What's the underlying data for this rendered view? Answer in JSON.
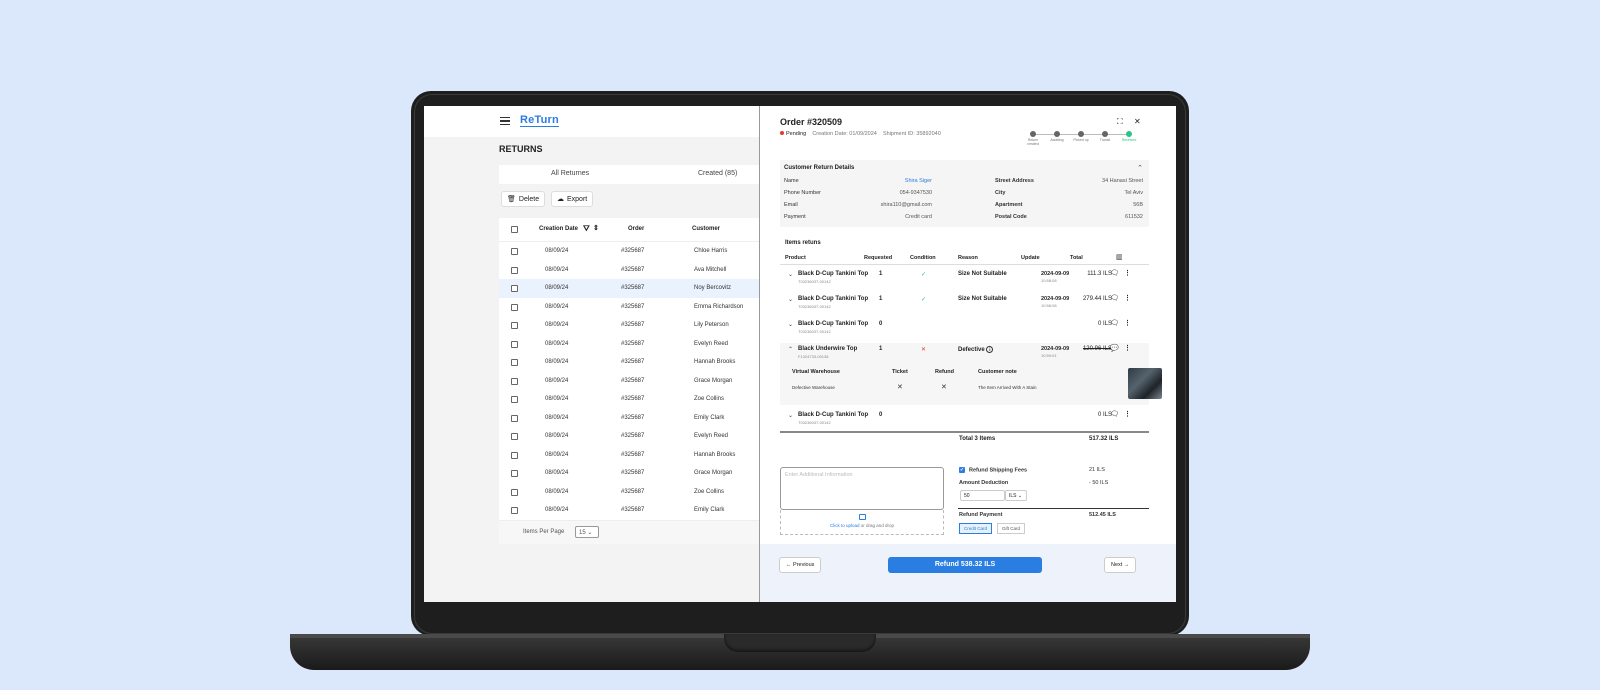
{
  "app": {
    "logo": "ReTurn"
  },
  "left": {
    "title": "RETURNS",
    "tabs": [
      "All Returnes",
      "Created (85)"
    ],
    "actions": {
      "delete": "Delete",
      "export": "Export"
    },
    "columns": [
      "Creation Date",
      "Order",
      "Customer"
    ],
    "rows": [
      {
        "date": "08/09/24",
        "order": "#325687",
        "customer": "Chloe Harris"
      },
      {
        "date": "08/09/24",
        "order": "#325687",
        "customer": "Ava Mitchell"
      },
      {
        "date": "08/09/24",
        "order": "#325687",
        "customer": "Noy Bercovitz"
      },
      {
        "date": "08/09/24",
        "order": "#325687",
        "customer": "Emma Richardson"
      },
      {
        "date": "08/09/24",
        "order": "#325687",
        "customer": "Lily Peterson"
      },
      {
        "date": "08/09/24",
        "order": "#325687",
        "customer": "Evelyn Reed"
      },
      {
        "date": "08/09/24",
        "order": "#325687",
        "customer": "Hannah Brooks"
      },
      {
        "date": "08/09/24",
        "order": "#325687",
        "customer": "Grace Morgan"
      },
      {
        "date": "08/09/24",
        "order": "#325687",
        "customer": "Zoe Collins"
      },
      {
        "date": "08/09/24",
        "order": "#325687",
        "customer": "Emily Clark"
      },
      {
        "date": "08/09/24",
        "order": "#325687",
        "customer": "Evelyn Reed"
      },
      {
        "date": "08/09/24",
        "order": "#325687",
        "customer": "Hannah Brooks"
      },
      {
        "date": "08/09/24",
        "order": "#325687",
        "customer": "Grace Morgan"
      },
      {
        "date": "08/09/24",
        "order": "#325687",
        "customer": "Zoe Collins"
      },
      {
        "date": "08/09/24",
        "order": "#325687",
        "customer": "Emily Clark"
      }
    ],
    "footer": {
      "items_label": "Items Per Page",
      "items_value": "15"
    }
  },
  "order": {
    "title": "Order #320509",
    "status": "Pending",
    "creation": "Creation Date: 01/09/2024",
    "shipment": "Shipment ID: 35892040",
    "steps": [
      "Return created",
      "Awaiting",
      "Picked up",
      "Transit",
      "Received"
    ]
  },
  "customer": {
    "header": "Customer Return Details",
    "left": [
      {
        "label": "Name",
        "value": "Shira Siger"
      },
      {
        "label": "Phone Number",
        "value": "054-9347530"
      },
      {
        "label": "Email",
        "value": "shira110@gmail.com"
      },
      {
        "label": "Payment",
        "value": "Credit card"
      }
    ],
    "right": [
      {
        "label": "Street Address",
        "value": "34 Hanasi Street"
      },
      {
        "label": "City",
        "value": "Tel Aviv"
      },
      {
        "label": "Apartment",
        "value": "56B"
      },
      {
        "label": "Postal Code",
        "value": "611532"
      }
    ]
  },
  "items": {
    "header": "Items retuns",
    "columns": [
      "Product",
      "Requested",
      "Condition",
      "Reason",
      "Update",
      "Total"
    ],
    "rows": [
      {
        "name": "Black D-Cup Tankini Top",
        "sku": "T03236037-00142",
        "requested": "1",
        "reason": "Size Not Suitable",
        "date": "2024-09-09",
        "time": "10:58:08",
        "total": "111.3 ILS"
      },
      {
        "name": "Black D-Cup Tankini Top",
        "sku": "T03236037-00142",
        "requested": "1",
        "reason": "Size Not Suitable",
        "date": "2024-09-09",
        "time": "10:58:08",
        "total": "279.44 ILS"
      },
      {
        "name": "Black D-Cup Tankini Top",
        "sku": "T03236037-00142",
        "requested": "0",
        "reason": "",
        "date": "",
        "time": "",
        "total": "0 ILS"
      },
      {
        "name": "Black Underwire Top",
        "sku": "F1324733-00138",
        "requested": "1",
        "reason": "Defective",
        "date": "2024-09-09",
        "time": "10:59:01",
        "total": "120.96 ILS"
      },
      {
        "name": "Black D-Cup Tankini Top",
        "sku": "T03236037-00142",
        "requested": "0",
        "reason": "",
        "date": "",
        "time": "",
        "total": "0 ILS"
      }
    ],
    "sub": {
      "headers": [
        "Virtual Warehouse",
        "Ticket",
        "Refund",
        "Customer note"
      ],
      "warehouse": "Defective Warehouse",
      "note": "The Item Arrived With A Stain"
    },
    "total_label": "Total 3 Items",
    "total_value": "517.32 ILS"
  },
  "refund": {
    "note_placeholder": "Enter Additional Information",
    "upload_link": "Click to upload",
    "upload_text": " or drag and drop",
    "shipping_label": "Refund Shipping Fees",
    "shipping_value": "21 ILS",
    "deduction_label": "Amount Deduction",
    "deduction_value": "- 50 ILS",
    "amount_input": "50",
    "currency": "ILS",
    "payment_label": "Refund Payment",
    "payment_value": "512.45 ILS",
    "methods": [
      "Credit Card",
      "Gift Card"
    ]
  },
  "footer": {
    "previous": "Previous",
    "refund": "Refund 538.32 ILS",
    "next": "Next"
  },
  "colors": {
    "accent": "#2a7de1",
    "success": "#2bc48a",
    "danger": "#e53935",
    "background": "#dbe8fc"
  }
}
